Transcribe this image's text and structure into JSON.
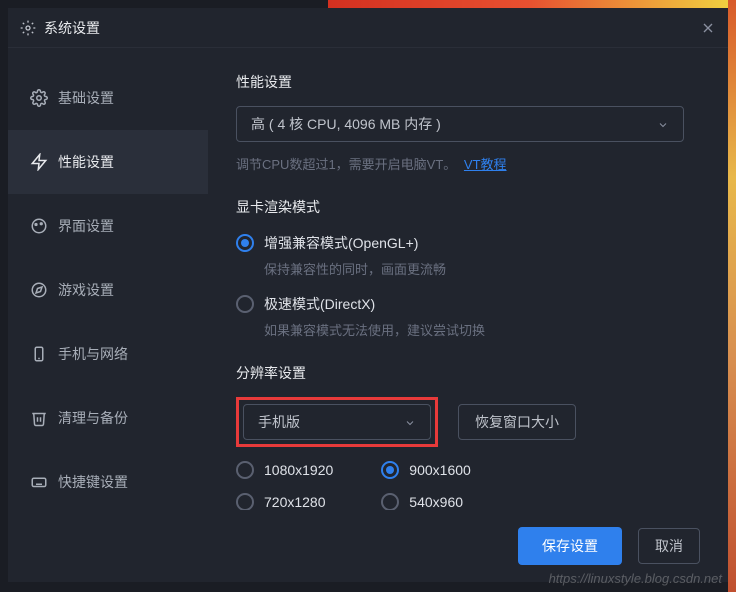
{
  "window": {
    "title": "系统设置"
  },
  "sidebar": {
    "items": [
      {
        "label": "基础设置"
      },
      {
        "label": "性能设置"
      },
      {
        "label": "界面设置"
      },
      {
        "label": "游戏设置"
      },
      {
        "label": "手机与网络"
      },
      {
        "label": "清理与备份"
      },
      {
        "label": "快捷键设置"
      }
    ]
  },
  "perf": {
    "title": "性能设置",
    "dropdown_value": "高 ( 4 核 CPU, 4096 MB 内存 )",
    "hint_prefix": "调节CPU数超过1，需要开启电脑VT。",
    "hint_link": "VT教程"
  },
  "render": {
    "title": "显卡渲染模式",
    "option1": "增强兼容模式(OpenGL+)",
    "option1_sub": "保持兼容性的同时，画面更流畅",
    "option2": "极速模式(DirectX)",
    "option2_sub": "如果兼容模式无法使用，建议尝试切换"
  },
  "resolution": {
    "title": "分辨率设置",
    "dropdown_value": "手机版",
    "reset_button": "恢复窗口大小",
    "options": {
      "r1": "1080x1920",
      "r2": "900x1600",
      "r3": "720x1280",
      "r4": "540x960"
    }
  },
  "footer": {
    "save": "保存设置",
    "cancel": "取消"
  },
  "watermark": "https://linuxstyle.blog.csdn.net"
}
